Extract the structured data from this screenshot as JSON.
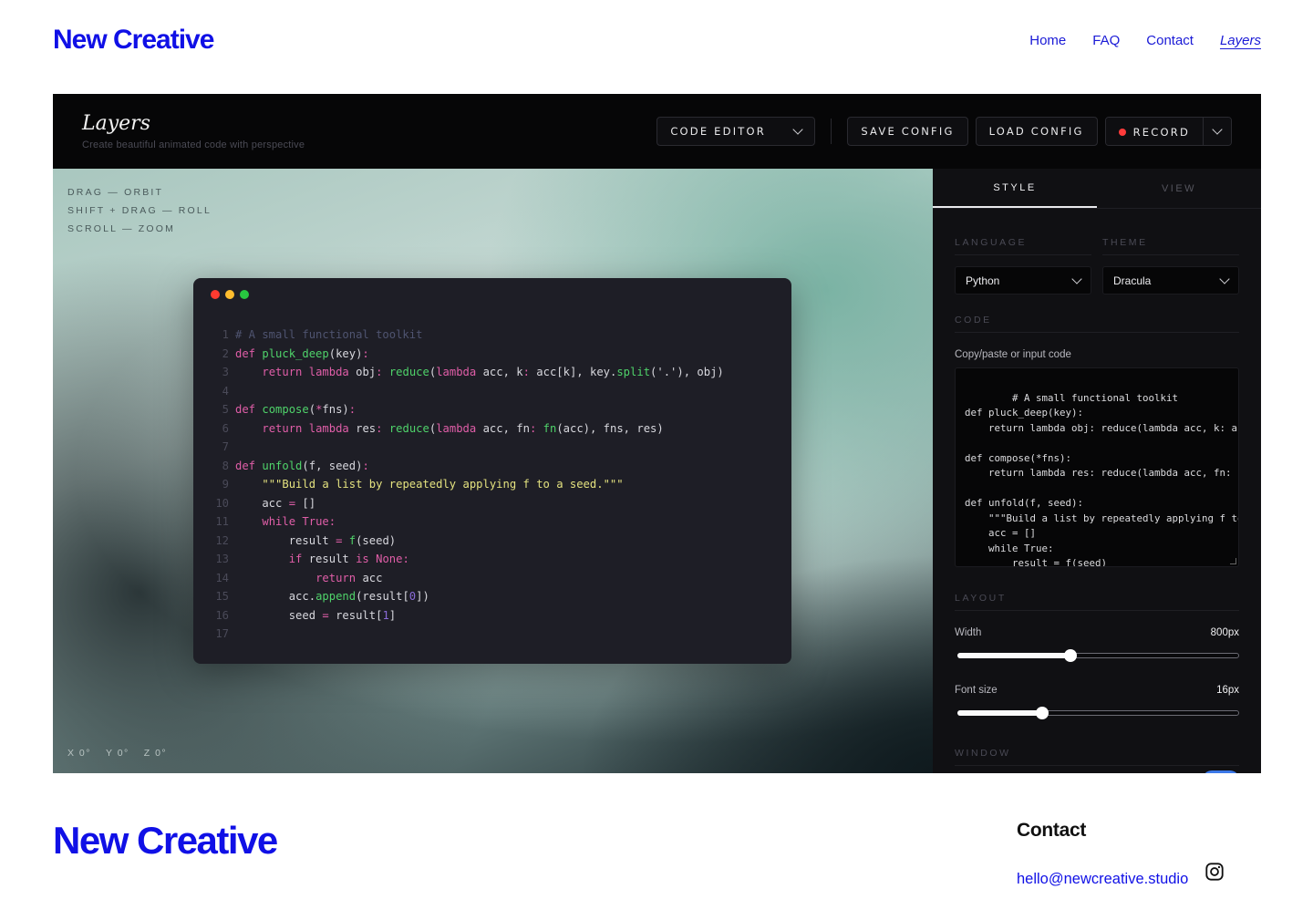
{
  "site": {
    "brand": "New Creative",
    "nav": [
      "Home",
      "FAQ",
      "Contact",
      "Layers"
    ]
  },
  "app": {
    "title": "Layers",
    "subtitle": "Create beautiful animated code with perspective",
    "mode_select": "CODE EDITOR",
    "save_config": "SAVE CONFIG",
    "load_config": "LOAD CONFIG",
    "record": "RECORD"
  },
  "canvas": {
    "hints": [
      "DRAG — ORBIT",
      "SHIFT + DRAG — ROLL",
      "SCROLL — ZOOM"
    ],
    "coords": [
      "X 0°",
      "Y 0°",
      "Z 0°"
    ],
    "traffic_colors": [
      "#ff3b30",
      "#ffbd2e",
      "#28c840"
    ]
  },
  "code_lines": [
    [
      [
        "c",
        "# A small functional toolkit"
      ]
    ],
    [
      [
        "k",
        "def "
      ],
      [
        "f",
        "pluck_deep"
      ],
      [
        "p",
        "(key)"
      ],
      [
        "o",
        ":"
      ]
    ],
    [
      [
        "p",
        "    "
      ],
      [
        "k",
        "return "
      ],
      [
        "k",
        "lambda "
      ],
      [
        "p",
        "obj"
      ],
      [
        "o",
        ": "
      ],
      [
        "f",
        "reduce"
      ],
      [
        "p",
        "("
      ],
      [
        "k",
        "lambda "
      ],
      [
        "p",
        "acc, k"
      ],
      [
        "o",
        ": "
      ],
      [
        "p",
        "acc[k], key."
      ],
      [
        "f",
        "split"
      ],
      [
        "p",
        "('.'), obj)"
      ]
    ],
    [],
    [
      [
        "k",
        "def "
      ],
      [
        "f",
        "compose"
      ],
      [
        "p",
        "("
      ],
      [
        "o",
        "*"
      ],
      [
        "p",
        "fns)"
      ],
      [
        "o",
        ":"
      ]
    ],
    [
      [
        "p",
        "    "
      ],
      [
        "k",
        "return "
      ],
      [
        "k",
        "lambda "
      ],
      [
        "p",
        "res"
      ],
      [
        "o",
        ": "
      ],
      [
        "f",
        "reduce"
      ],
      [
        "p",
        "("
      ],
      [
        "k",
        "lambda "
      ],
      [
        "p",
        "acc, fn"
      ],
      [
        "o",
        ": "
      ],
      [
        "f",
        "fn"
      ],
      [
        "p",
        "(acc), fns, res)"
      ]
    ],
    [],
    [
      [
        "k",
        "def "
      ],
      [
        "f",
        "unfold"
      ],
      [
        "p",
        "(f, seed)"
      ],
      [
        "o",
        ":"
      ]
    ],
    [
      [
        "p",
        "    "
      ],
      [
        "s",
        "\"\"\"Build a list by repeatedly applying f to a seed.\"\"\""
      ]
    ],
    [
      [
        "p",
        "    acc "
      ],
      [
        "o",
        "= "
      ],
      [
        "p",
        "[]"
      ]
    ],
    [
      [
        "p",
        "    "
      ],
      [
        "k",
        "while "
      ],
      [
        "k",
        "True"
      ],
      [
        "o",
        ":"
      ]
    ],
    [
      [
        "p",
        "        result "
      ],
      [
        "o",
        "= "
      ],
      [
        "f",
        "f"
      ],
      [
        "p",
        "(seed)"
      ]
    ],
    [
      [
        "p",
        "        "
      ],
      [
        "k",
        "if "
      ],
      [
        "p",
        "result "
      ],
      [
        "k",
        "is "
      ],
      [
        "k",
        "None"
      ],
      [
        "o",
        ":"
      ]
    ],
    [
      [
        "p",
        "            "
      ],
      [
        "k",
        "return "
      ],
      [
        "p",
        "acc"
      ]
    ],
    [
      [
        "p",
        "        acc."
      ],
      [
        "f",
        "append"
      ],
      [
        "p",
        "(result["
      ],
      [
        "n",
        "0"
      ],
      [
        "p",
        "])"
      ]
    ],
    [
      [
        "p",
        "        seed "
      ],
      [
        "o",
        "= "
      ],
      [
        "p",
        "result["
      ],
      [
        "n",
        "1"
      ],
      [
        "p",
        "]"
      ]
    ],
    []
  ],
  "panel": {
    "tabs": [
      "STYLE",
      "VIEW"
    ],
    "language_label": "LANGUAGE",
    "language_value": "Python",
    "theme_label": "THEME",
    "theme_value": "Dracula",
    "code_label": "CODE",
    "code_input_label": "Copy/paste or input code",
    "code_text": "# A small functional toolkit\ndef pluck_deep(key):\n    return lambda obj: reduce(lambda acc, k: acc[k], key.split('.'), obj)\n\ndef compose(*fns):\n    return lambda res: reduce(lambda acc, fn: fn(acc), fns, res)\n\ndef unfold(f, seed):\n    \"\"\"Build a list by repeatedly applying f to a seed.\"\"\"\n    acc = []\n    while True:\n        result = f(seed)\n        if result is None:",
    "layout_label": "LAYOUT",
    "width_label": "Width",
    "width_value": "800px",
    "width_fraction": 0.4,
    "fontsize_label": "Font size",
    "fontsize_value": "16px",
    "fontsize_fraction": 0.3,
    "window_label": "WINDOW"
  },
  "footer": {
    "brand": "New Creative",
    "contact_title": "Contact",
    "email": "hello@newcreative.studio",
    "instagram_icon": "instagram-icon"
  }
}
